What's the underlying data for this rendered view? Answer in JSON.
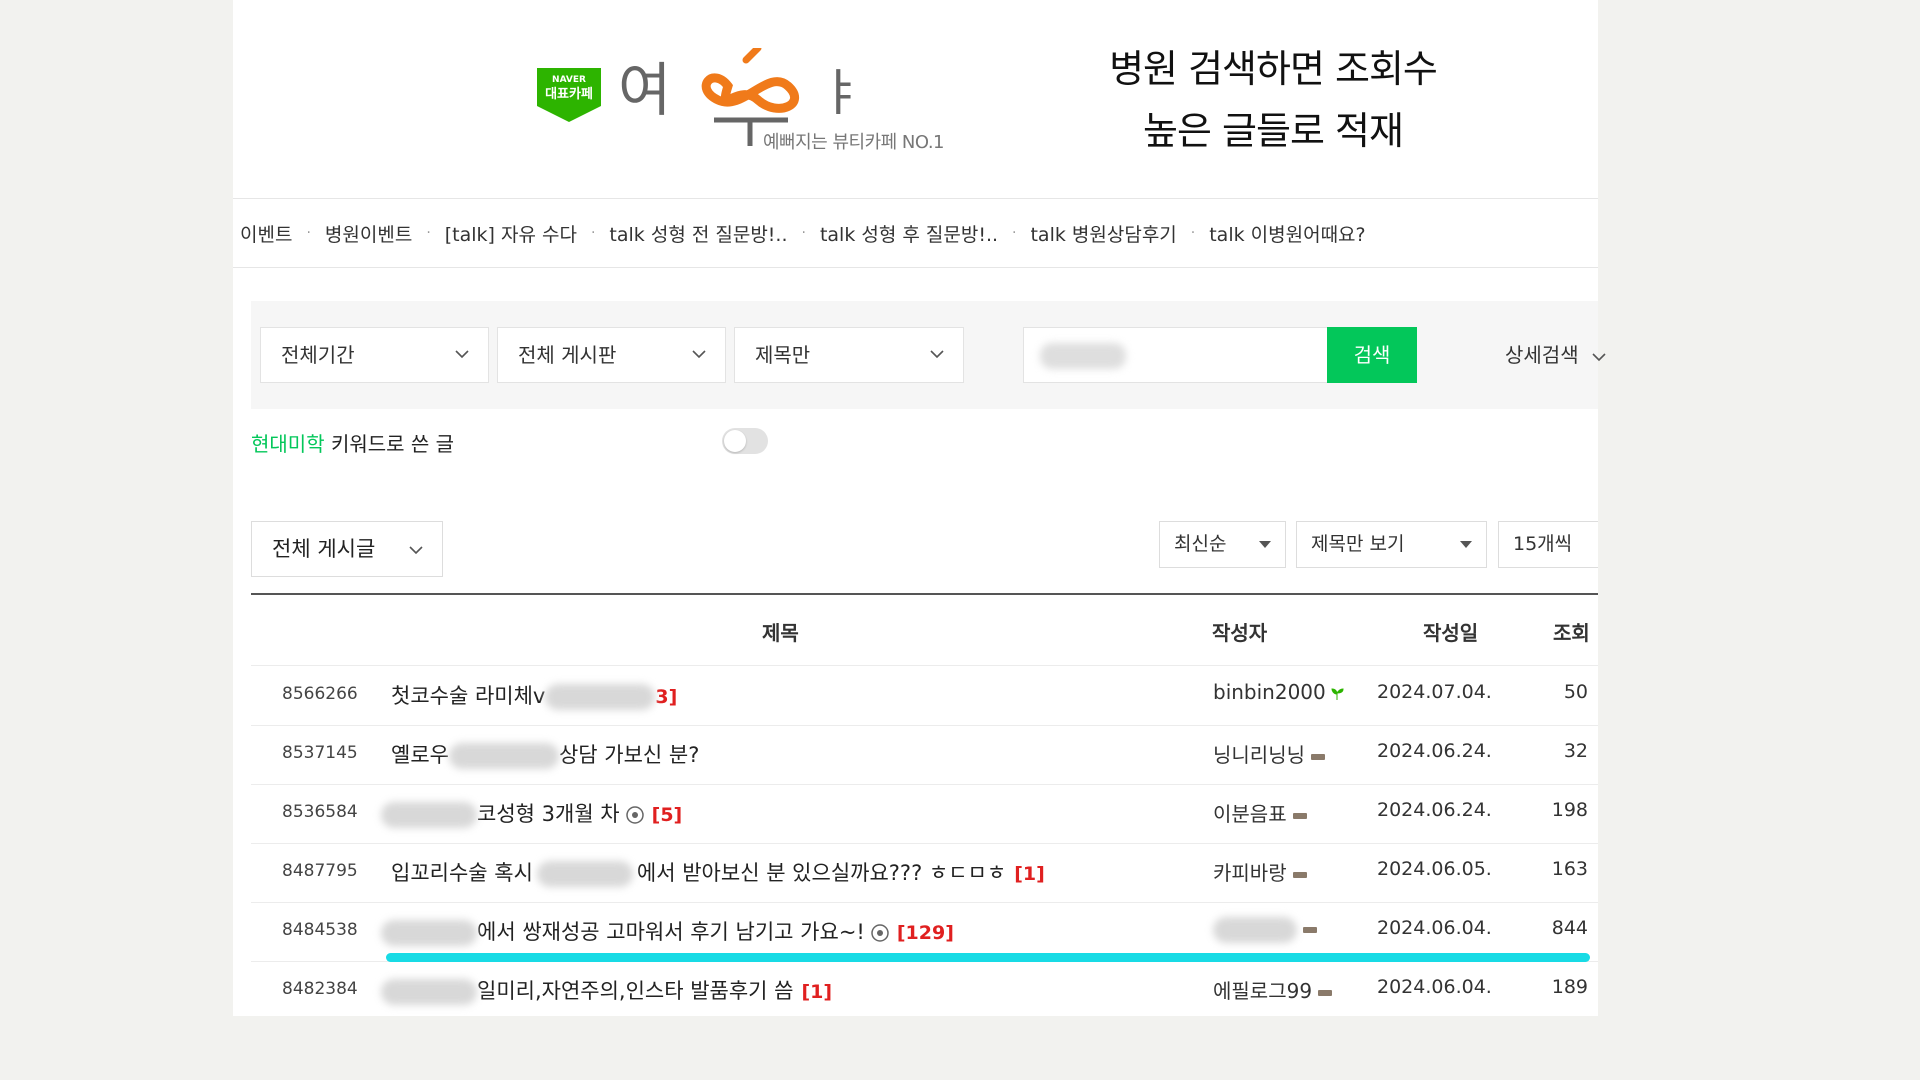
{
  "header": {
    "badge_text": "대표카페",
    "badge_top": "NAVER",
    "logo_text": "여우야",
    "logo_sub": "예뻐지는 뷰티카페 NO.1",
    "caption_line1": "병원 검색하면 조회수",
    "caption_line2": "높은 글들로 적재"
  },
  "nav": [
    "이벤트",
    "병원이벤트",
    "[talk] 자유 수다",
    "talk 성형 전 질문방!..",
    "talk 성형 후 질문방!..",
    "talk 병원상담후기",
    "talk 이병원어때요?"
  ],
  "search": {
    "period": "전체기간",
    "board": "전체 게시판",
    "scope": "제목만",
    "button": "검색",
    "advanced": "상세검색"
  },
  "keyword": {
    "brand": "현대미학",
    "rest": " 키워드로 쓴 글"
  },
  "filters": {
    "all_posts": "전체 게시글",
    "sort": "최신순",
    "view": "제목만 보기",
    "per_page": "15개씩"
  },
  "table": {
    "headers": {
      "title": "제목",
      "author": "작성자",
      "date": "작성일",
      "views": "조회"
    },
    "rows": [
      {
        "num": "8566266",
        "title_pre": "첫코수술 라미체v",
        "title_post": "3]",
        "count": "",
        "author": "binbin2000",
        "date": "2024.07.04.",
        "views": "50"
      },
      {
        "num": "8537145",
        "title_pre": "옐로우",
        "title_post": "상담 가보신 분?",
        "count": "",
        "author": "닝니리닝닝",
        "date": "2024.06.24.",
        "views": "32"
      },
      {
        "num": "8536584",
        "title_pre": "",
        "title_post": "코성형 3개월 차",
        "count": "[5]",
        "author": "이분음표",
        "date": "2024.06.24.",
        "views": "198"
      },
      {
        "num": "8487795",
        "title_pre": "입꼬리수술 혹시",
        "title_post": "에서 받아보신 분 있으실까요??? ㅎㄷㅁㅎ",
        "count": "[1]",
        "author": "카피바랑",
        "date": "2024.06.05.",
        "views": "163"
      },
      {
        "num": "8484538",
        "title_pre": "",
        "title_post": "에서 쌍재성공 고마워서 후기 남기고 가요~!",
        "count": "[129]",
        "author": "",
        "date": "2024.06.04.",
        "views": "844"
      },
      {
        "num": "8482384",
        "title_pre": "",
        "title_post": "일미리,자연주의,인스타 발품후기 씀",
        "count": "[1]",
        "author": "에필로그99",
        "date": "2024.06.04.",
        "views": "189"
      }
    ]
  },
  "colors": {
    "accent": "#03c75a",
    "highlight": "#18dbe5",
    "count_red": "#e02020"
  }
}
